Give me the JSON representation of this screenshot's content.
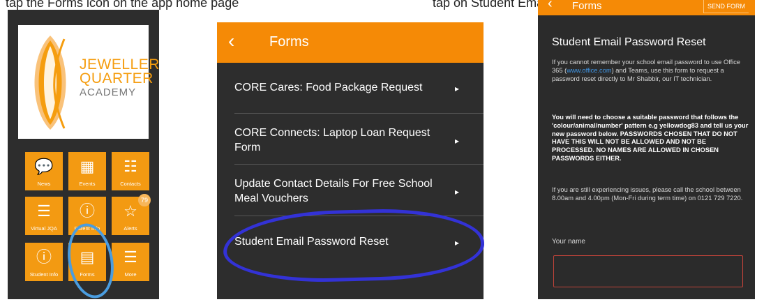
{
  "caption": {
    "left": "tap the Forms icon on the app home page",
    "right": "tap on Student Email Password Reset on the Forms page"
  },
  "phone1": {
    "logo": {
      "line1": "JEWELLERY",
      "line2": "QUARTER",
      "line3": "ACADEMY"
    },
    "tiles": [
      {
        "label": "News",
        "icon": "chat-bubble-icon",
        "glyph": "💬"
      },
      {
        "label": "Events",
        "icon": "calendar-icon",
        "glyph": "▦"
      },
      {
        "label": "Contacts",
        "icon": "contact-card-icon",
        "glyph": "☷"
      },
      {
        "label": "Virtual JQA",
        "icon": "document-icon",
        "glyph": "☰"
      },
      {
        "label": "Parent Info",
        "icon": "info-icon",
        "glyph": "ⓘ"
      },
      {
        "label": "Alerts",
        "icon": "star-icon",
        "glyph": "☆",
        "badge": "79"
      },
      {
        "label": "Student Info",
        "icon": "info-icon",
        "glyph": "ⓘ"
      },
      {
        "label": "Forms",
        "icon": "form-icon",
        "glyph": "▤"
      },
      {
        "label": "More",
        "icon": "list-icon",
        "glyph": "☰"
      }
    ]
  },
  "phone2": {
    "header": {
      "title": "Forms",
      "back_glyph": "‹"
    },
    "items": [
      {
        "label": "CORE Cares: Food Package Request"
      },
      {
        "label": "CORE Connects: Laptop Loan Request Form"
      },
      {
        "label": "Update Contact Details For Free School Meal Vouchers"
      },
      {
        "label": "Student Email Password Reset"
      }
    ],
    "chevron": "▸"
  },
  "phone3": {
    "header": {
      "title": "Forms",
      "back_glyph": "‹",
      "send_label": "SEND FORM"
    },
    "form_title": "Student Email Password Reset",
    "intro_before": "If you cannot remember your school email password to use Office 365 (",
    "intro_link": "www.office.com",
    "intro_after": ") and Teams, use this form to request a password reset directly to Mr Shabbir, our IT technician.",
    "bold_text": "You will need to choose a suitable password that follows the 'colour/animal/number' pattern e.g yellowdog83 and tell us your new password below. PASSWORDS CHOSEN THAT DO NOT HAVE THIS WILL NOT BE ALLOWED AND NOT BE PROCESSED. NO NAMES ARE ALLOWED IN CHOSEN PASSWORDS EITHER.",
    "help_text": "If you are still experiencing issues, please call the school between 8.00am and 4.00pm (Mon-Fri during term time) on 0121 729 7220.",
    "name_label": "Your name",
    "name_value": ""
  },
  "colors": {
    "accent": "#f58a06",
    "tile": "#f39a12",
    "background": "#2d2d2d",
    "link": "#3f96e6",
    "highlight_light_blue": "#4a9de0",
    "highlight_dark_blue": "#3332d6"
  }
}
